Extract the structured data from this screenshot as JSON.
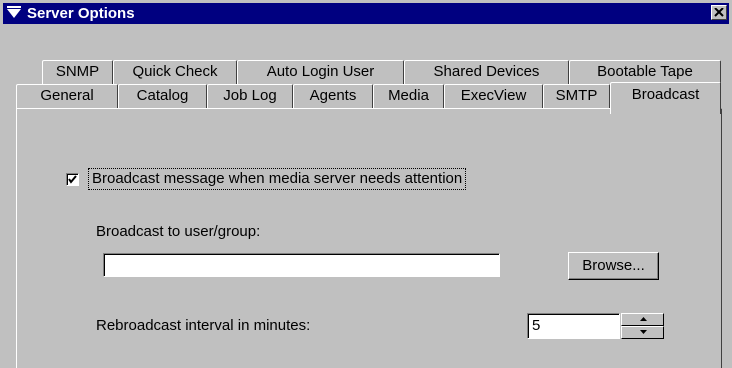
{
  "window": {
    "title": "Server Options",
    "title_icon": "funnel-icon",
    "close_icon": "close-icon",
    "titlebar_color": "#000080"
  },
  "tabs_row1": [
    "SNMP",
    "Quick Check",
    "Auto Login User",
    "Shared Devices",
    "Bootable Tape"
  ],
  "tabs_row2": [
    "General",
    "Catalog",
    "Job Log",
    "Agents",
    "Media",
    "ExecView",
    "SMTP",
    "Broadcast"
  ],
  "active_tab": "Broadcast",
  "broadcast": {
    "checkbox_label": "Broadcast message when media server needs attention",
    "checkbox_checked": true,
    "user_group_label": "Broadcast to user/group:",
    "user_group_value": "",
    "browse_label": "Browse...",
    "interval_label": "Rebroadcast interval in minutes:",
    "interval_value": "5"
  }
}
